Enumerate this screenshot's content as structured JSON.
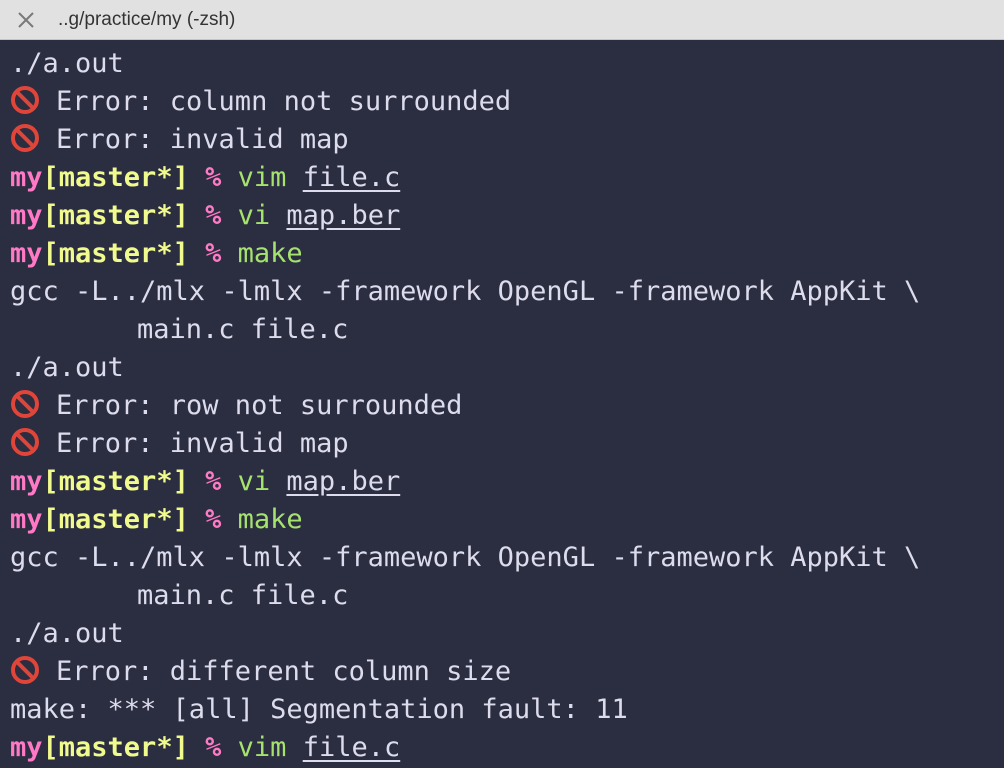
{
  "window": {
    "title": "..g/practice/my (-zsh)",
    "close_icon": "close-icon"
  },
  "theme": {
    "background": "#2b2e40",
    "text": "#dcdcec",
    "prompt_dir": "#ff79c6",
    "prompt_branch": "#f1fa8c",
    "command": "#a6e36e",
    "error_icon": "#e0453a"
  },
  "prompt": {
    "dir": "my",
    "open": "[",
    "branch": "master*",
    "close": "]",
    "symbol": "%"
  },
  "lines": [
    {
      "type": "output",
      "text": "./a.out"
    },
    {
      "type": "error",
      "icon": "no-entry-icon",
      "text": "Error: column not surrounded"
    },
    {
      "type": "error",
      "icon": "no-entry-icon",
      "text": "Error: invalid map"
    },
    {
      "type": "prompt",
      "cmd": "vim",
      "arg": "file.c"
    },
    {
      "type": "prompt",
      "cmd": "vi",
      "arg": "map.ber"
    },
    {
      "type": "prompt",
      "cmd": "make",
      "arg": ""
    },
    {
      "type": "output",
      "text": "gcc -L../mlx -lmlx -framework OpenGL -framework AppKit \\"
    },
    {
      "type": "output-indent",
      "text": "main.c file.c"
    },
    {
      "type": "output",
      "text": "./a.out"
    },
    {
      "type": "error",
      "icon": "no-entry-icon",
      "text": "Error: row not surrounded"
    },
    {
      "type": "error",
      "icon": "no-entry-icon",
      "text": "Error: invalid map"
    },
    {
      "type": "prompt",
      "cmd": "vi",
      "arg": "map.ber"
    },
    {
      "type": "prompt",
      "cmd": "make",
      "arg": ""
    },
    {
      "type": "output",
      "text": "gcc -L../mlx -lmlx -framework OpenGL -framework AppKit \\"
    },
    {
      "type": "output-indent",
      "text": "main.c file.c"
    },
    {
      "type": "output",
      "text": "./a.out"
    },
    {
      "type": "error",
      "icon": "no-entry-icon",
      "text": "Error: different column size"
    },
    {
      "type": "output",
      "text": "make: *** [all] Segmentation fault: 11"
    },
    {
      "type": "prompt",
      "cmd": "vim",
      "arg": "file.c"
    }
  ]
}
